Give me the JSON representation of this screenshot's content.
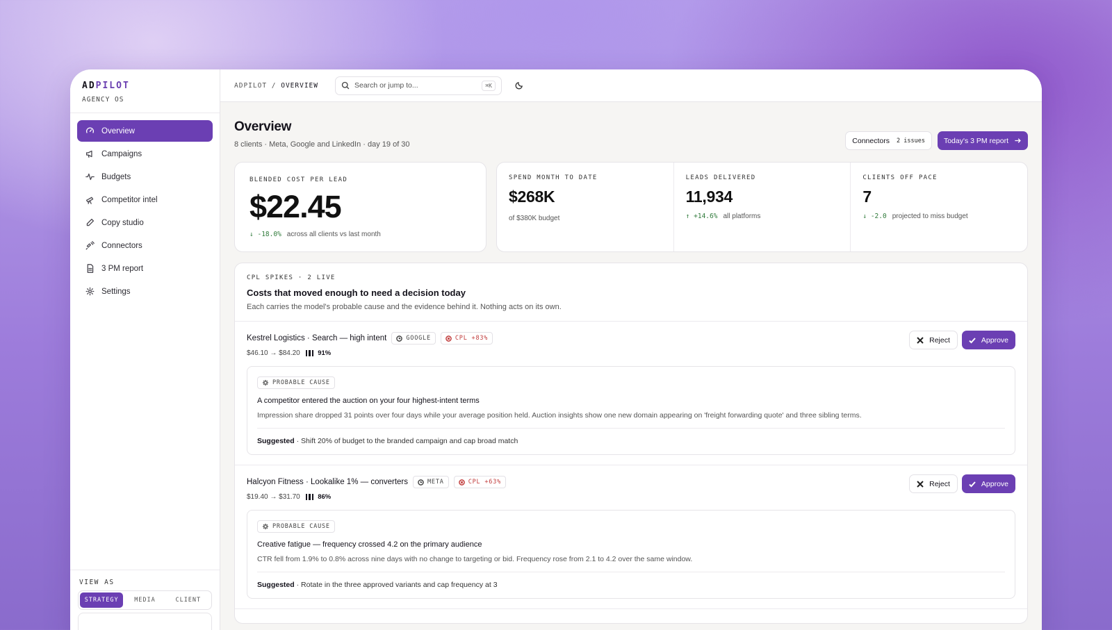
{
  "brand": {
    "name_a": "AD",
    "name_b": "PILOT",
    "sub": "AGENCY OS"
  },
  "nav": [
    {
      "label": "Overview",
      "icon": "gauge-icon",
      "active": true
    },
    {
      "label": "Campaigns",
      "icon": "megaphone-icon"
    },
    {
      "label": "Budgets",
      "icon": "activity-icon"
    },
    {
      "label": "Competitor intel",
      "icon": "telescope-icon"
    },
    {
      "label": "Copy studio",
      "icon": "pen-icon"
    },
    {
      "label": "Connectors",
      "icon": "plug-icon"
    },
    {
      "label": "3 PM report",
      "icon": "document-icon"
    },
    {
      "label": "Settings",
      "icon": "gear-icon"
    }
  ],
  "view_as": {
    "label": "VIEW AS",
    "options": [
      "STRATEGY",
      "MEDIA",
      "CLIENT"
    ],
    "selected": "STRATEGY"
  },
  "topbar": {
    "crumb_root": "ADPILOT",
    "crumb_sep": " / ",
    "crumb_current": "OVERVIEW",
    "search_placeholder": "Search or jump to...",
    "search_kbd": "⌘K"
  },
  "page": {
    "title": "Overview",
    "subtitle": "8 clients · Meta, Google and LinkedIn · day 19 of 30",
    "connectors_label": "Connectors",
    "connectors_issues": "2 issues",
    "report_button": "Today's 3 PM report"
  },
  "kpis": {
    "blended": {
      "label": "BLENDED COST PER LEAD",
      "value": "$22.45",
      "delta": "-18.0%",
      "note": "across all clients vs last month"
    },
    "spend": {
      "label": "SPEND MONTH TO DATE",
      "value": "$268K",
      "note": "of $380K budget"
    },
    "leads": {
      "label": "LEADS DELIVERED",
      "value": "11,934",
      "delta": "+14.6%",
      "note": "all platforms"
    },
    "offpace": {
      "label": "CLIENTS OFF PACE",
      "value": "7",
      "delta": "-2.0",
      "note": "projected to miss budget"
    }
  },
  "spikes_panel": {
    "eyebrow": "CPL SPIKES · 2 LIVE",
    "title": "Costs that moved enough to need a decision today",
    "desc": "Each carries the model's probable cause and the evidence behind it. Nothing acts on its own.",
    "reject_label": "Reject",
    "approve_label": "Approve",
    "cause_label": "PROBABLE CAUSE",
    "suggested_label": "Suggested",
    "items": [
      {
        "title": "Kestrel Logistics · Search — high intent",
        "platform": "GOOGLE",
        "cpl": "CPL +83%",
        "range": "$46.10 → $84.20",
        "confidence": "91%",
        "cause_title": "A competitor entered the auction on your four highest-intent terms",
        "cause_body": "Impression share dropped 31 points over four days while your average position held. Auction insights show one new domain appearing on 'freight forwarding quote' and three sibling terms.",
        "suggestion": " · Shift 20% of budget to the branded campaign and cap broad match"
      },
      {
        "title": "Halcyon Fitness · Lookalike 1% — converters",
        "platform": "META",
        "cpl": "CPL +63%",
        "range": "$19.40 → $31.70",
        "confidence": "86%",
        "cause_title": "Creative fatigue — frequency crossed 4.2 on the primary audience",
        "cause_body": "CTR fell from 1.9% to 0.8% across nine days with no change to targeting or bid. Frequency rose from 2.1 to 4.2 over the same window.",
        "suggestion": " · Rotate in the three approved variants and cap frequency at 3"
      }
    ]
  },
  "colors": {
    "accent": "#6b3fb3",
    "positive": "#2f7a3a",
    "negative": "#c03a3a"
  }
}
